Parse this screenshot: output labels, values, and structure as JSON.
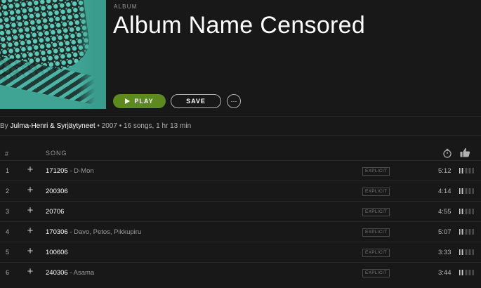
{
  "album": {
    "type_label": "ALBUM",
    "title": "Album Name Censored",
    "buttons": {
      "play": "PLAY",
      "save": "SAVE",
      "more": "···"
    }
  },
  "byline": {
    "prefix": "By ",
    "artist": "Julma-Henri & Syrjäytyneet",
    "details": " • 2007 • 16 songs, 1 hr 13 min"
  },
  "table": {
    "headers": {
      "number": "#",
      "song": "SONG"
    },
    "icons": {
      "duration": "stopwatch-icon",
      "popularity": "thumbs-up-icon",
      "add": "plus-icon"
    },
    "tracks": [
      {
        "number": "1",
        "title": "171205",
        "feat": " - D-Mon",
        "explicit": "EXPLICIT",
        "duration": "5:12",
        "popularity": 0.25
      },
      {
        "number": "2",
        "title": "200306",
        "feat": "",
        "explicit": "EXPLICIT",
        "duration": "4:14",
        "popularity": 0.25
      },
      {
        "number": "3",
        "title": "20706",
        "feat": "",
        "explicit": "EXPLICIT",
        "duration": "4:55",
        "popularity": 0.25
      },
      {
        "number": "4",
        "title": "170306",
        "feat": " - Davo, Petos, Pikkupiru",
        "explicit": "EXPLICIT",
        "duration": "5:07",
        "popularity": 0.25
      },
      {
        "number": "5",
        "title": "100606",
        "feat": "",
        "explicit": "EXPLICIT",
        "duration": "3:33",
        "popularity": 0.25
      },
      {
        "number": "6",
        "title": "240306",
        "feat": " - Asama",
        "explicit": "EXPLICIT",
        "duration": "3:44",
        "popularity": 0.25
      }
    ]
  },
  "colors": {
    "background": "#181818",
    "accent": "#5d8a1f",
    "muted_text": "#b3b3b3"
  }
}
